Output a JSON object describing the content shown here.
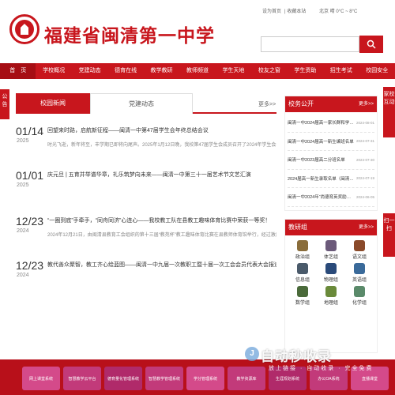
{
  "header": {
    "site_title": "福建省闽清第一中学",
    "top_links": [
      "设为首页",
      "收藏本站"
    ],
    "weather": "北京  晴  0°C ~ 8°C"
  },
  "nav": {
    "items": [
      "首　页",
      "学校概况",
      "党建动态",
      "德育在线",
      "教学教研",
      "教师频道",
      "学生天地",
      "校友之窗",
      "学生资助",
      "招生考试",
      "校园安全"
    ]
  },
  "side_tabs": {
    "left": "公告",
    "right_1": "家校互动",
    "right_2": "扫一扫"
  },
  "news": {
    "tabs": [
      "校园新闻",
      "党建动态"
    ],
    "more": "更多>>",
    "items": [
      {
        "date": "01/14",
        "year": "2025",
        "title": "回望来时路，启航新征程——闽清一中第47届学生会年终总结会议",
        "summary": "时光飞逝，新年将至，丰学期已即将向尾声。2025年1月12日晚，我校第47届学生会成员召开了2024年学生会年终总"
      },
      {
        "date": "01/01",
        "year": "2025",
        "title": "庆元旦 | 五育并举谱华章，礼乐筑梦向未来——闽清一中第三十一届艺术节文艺汇演",
        "summary": ""
      },
      {
        "date": "12/23",
        "year": "2024",
        "title": "“一圈到底”手牵手，“同舟同济”心连心——我校教工队在县教工趣味体育比赛中荣获一等奖！",
        "summary": "2024年12月21日，由闽清县教育工会组织的第十三届“教苑杯”教工趣味体育比赛在县教师体育馆举行，经过激烈角"
      },
      {
        "date": "12/23",
        "year": "2024",
        "title": "教代善众聚智，教工齐心绘蓝图——闽清一中九届一次教职工暨十届一次工会会员代表大会报道",
        "summary": ""
      }
    ]
  },
  "notices": {
    "title": "校务公开",
    "more": "更多>>",
    "items": [
      {
        "title": "闽清一中2024届高一家长群和学…",
        "date": "2024-08-01"
      },
      {
        "title": "闽清一中2024届高一新生编班名单",
        "date": "2024-07-31"
      },
      {
        "title": "闽清一中2023届高二分班名单",
        "date": "2024-07-30"
      },
      {
        "title": "2024届高一新生录取名单（闽清…",
        "date": "2024-07-19"
      },
      {
        "title": "闽清一中2024年“尚德育英奖励…",
        "date": "2024-06-05"
      }
    ]
  },
  "groups": {
    "title": "教研组",
    "more": "更多>>",
    "items": [
      {
        "label": "政治组",
        "icon": "scale-icon",
        "color": "#8a6d3b"
      },
      {
        "label": "体艺组",
        "icon": "runner-icon",
        "color": "#6b5a7a"
      },
      {
        "label": "语文组",
        "icon": "book-icon",
        "color": "#8a4a2a"
      },
      {
        "label": "信息组",
        "icon": "computer-icon",
        "color": "#4a5a6a"
      },
      {
        "label": "物理组",
        "icon": "magnet-icon",
        "color": "#2a4a7a"
      },
      {
        "label": "英语组",
        "icon": "globe-icon",
        "color": "#3a6a9a"
      },
      {
        "label": "数学组",
        "icon": "math-icon",
        "color": "#4a6a3a"
      },
      {
        "label": "地理组",
        "icon": "map-icon",
        "color": "#6a8a3a"
      },
      {
        "label": "化学组",
        "icon": "flask-icon",
        "color": "#5a8a6a"
      }
    ]
  },
  "bottom_links": [
    {
      "label": "网上课堂系统",
      "color": "#d44a8a"
    },
    {
      "label": "智慧教学云平台",
      "color": "#c23a7a"
    },
    {
      "label": "德育量化管理系统",
      "color": "#b02a6a"
    },
    {
      "label": "智慧教学管理系统",
      "color": "#c23a7a"
    },
    {
      "label": "学分管理系统",
      "color": "#d44a8a"
    },
    {
      "label": "教学资源库",
      "color": "#c23a7a"
    },
    {
      "label": "生涯规划系统",
      "color": "#b02a6a"
    },
    {
      "label": "办公OA系统",
      "color": "#c23a7a"
    },
    {
      "label": "直播课堂",
      "color": "#d44a8a"
    }
  ],
  "watermark": {
    "main": "自动秒收录",
    "sub": "放上链接 · 自动收录 · 完全免费"
  },
  "colors": {
    "brand": "#c8161d",
    "nav_active": "#a60e14"
  }
}
